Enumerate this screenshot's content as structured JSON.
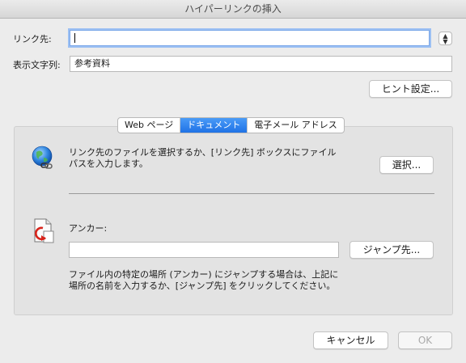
{
  "window": {
    "title": "ハイパーリンクの挿入"
  },
  "link_to": {
    "label": "リンク先:",
    "value": ""
  },
  "display_text": {
    "label": "表示文字列:",
    "value": "参考資料"
  },
  "screentip_button": "ヒント設定...",
  "tabs": [
    {
      "label": "Web ページ",
      "active": false
    },
    {
      "label": "ドキュメント",
      "active": true
    },
    {
      "label": "電子メール アドレス",
      "active": false
    }
  ],
  "document": {
    "instruction_line1": "リンク先のファイルを選択するか、[リンク先] ボックスにファイル",
    "instruction_line2": "パスを入力します。",
    "select_button": "選択...",
    "anchor_label": "アンカー:",
    "anchor_value": "",
    "jump_button": "ジャンプ先...",
    "anchor_help_line1": "ファイル内の特定の場所 (アンカー) にジャンプする場合は、上記に",
    "anchor_help_line2": "場所の名前を入力するか、[ジャンプ先] をクリックしてください。"
  },
  "footer": {
    "cancel_button": "キャンセル",
    "ok_button": "OK"
  },
  "icons": {
    "stepper": "chevron-up-down-icon",
    "link": "globe-link-icon",
    "anchor": "document-anchor-icon"
  },
  "colors": {
    "accent": "#1f72e6",
    "focus_ring": "#9cc0f3"
  }
}
